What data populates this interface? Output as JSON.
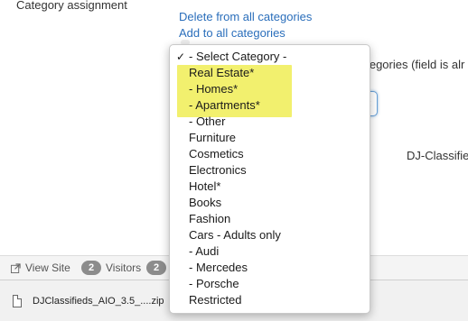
{
  "form": {
    "category_label": "Category assignment",
    "delete_link": "Delete from all categories",
    "add_link": "Add to all categories",
    "behind_note": "ategories (field is alr",
    "behind_djc": "DJ-Classifie"
  },
  "dropdown": {
    "selected": "- Select Category -",
    "options": [
      "- Select Category -",
      "Real Estate*",
      "- Homes*",
      "- Apartments*",
      "- Other",
      "Furniture",
      "Cosmetics",
      "Electronics",
      "Hotel*",
      "Books",
      "Fashion",
      "Cars - Adults only",
      "- Audi",
      "- Mercedes",
      "- Porsche",
      "Restricted"
    ],
    "highlight_color": "#f2f06e"
  },
  "statusbar": {
    "view_site": "View Site",
    "badge_count_1": "2",
    "visitors": "Visitors",
    "badge_count_2": "2"
  },
  "downloads": {
    "file_name": "DJClassifieds_AIO_3.5_....zip"
  },
  "colors": {
    "link": "#2a6ebb",
    "badge": "#8c8c8c"
  }
}
